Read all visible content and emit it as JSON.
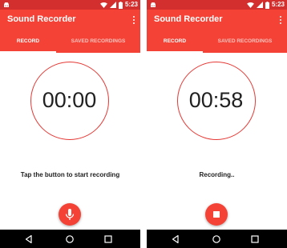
{
  "colors": {
    "status_bar": "#d32f2f",
    "app_bar": "#f44336",
    "accent": "#f44336",
    "timer_ring": "#e53935",
    "nav_bar": "#000000"
  },
  "screens": [
    {
      "status_bar": {
        "time": "5:23",
        "icons": [
          "android-notification-icon",
          "wifi-icon",
          "signal-icon",
          "battery-icon"
        ]
      },
      "app_bar": {
        "title": "Sound Recorder",
        "menu_icon": "overflow-menu-icon"
      },
      "tabs": [
        {
          "label": "RECORD",
          "selected": true
        },
        {
          "label": "SAVED RECORDINGS",
          "selected": false
        }
      ],
      "timer": "00:00",
      "status_text": "Tap the button to start recording",
      "fab": {
        "icon": "microphone-icon",
        "action": "start-recording"
      },
      "nav_bar": {
        "icons": [
          "back-icon",
          "home-icon",
          "recents-icon"
        ]
      }
    },
    {
      "status_bar": {
        "time": "5:23",
        "icons": [
          "android-notification-icon",
          "wifi-icon",
          "signal-icon",
          "battery-icon"
        ]
      },
      "app_bar": {
        "title": "Sound Recorder",
        "menu_icon": "overflow-menu-icon"
      },
      "tabs": [
        {
          "label": "RECORD",
          "selected": true
        },
        {
          "label": "SAVED RECORDINGS",
          "selected": false
        }
      ],
      "timer": "00:58",
      "status_text": "Recording..",
      "fab": {
        "icon": "stop-icon",
        "action": "stop-recording"
      },
      "nav_bar": {
        "icons": [
          "back-icon",
          "home-icon",
          "recents-icon"
        ]
      }
    }
  ]
}
